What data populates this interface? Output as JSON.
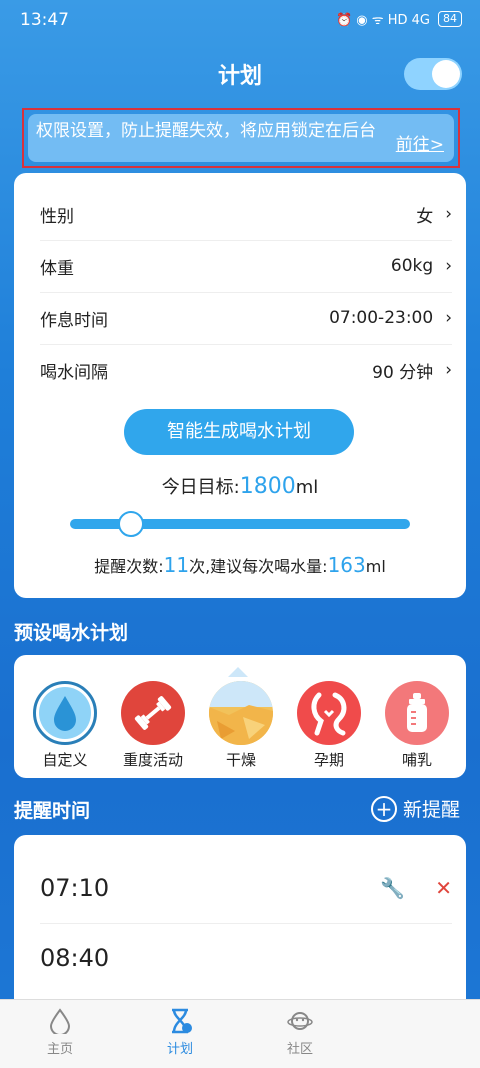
{
  "status": {
    "time": "13:47",
    "icons": "⏰ ◉ ᯤ HD 4G",
    "battery": "84"
  },
  "header": {
    "title": "计划"
  },
  "notice": {
    "text": "权限设置，防止提醒失效，将应用锁定在后台",
    "link": "前往>"
  },
  "settings": {
    "rows": [
      {
        "label": "性别",
        "value": "女"
      },
      {
        "label": "体重",
        "value": "60kg"
      },
      {
        "label": "作息时间",
        "value": "07:00-23:00"
      },
      {
        "label": "喝水间隔",
        "value": "90 分钟"
      }
    ],
    "chevron": "›",
    "generate_button": "智能生成喝水计划",
    "goal_prefix": "今日目标:",
    "goal_value": "1800",
    "goal_unit": "ml",
    "slider_level": 0.18,
    "tip_prefix": "提醒次数:",
    "tip_count": "11",
    "tip_mid": "次,建议每次喝水量:",
    "tip_amount": "163",
    "tip_unit": "ml"
  },
  "presets": {
    "title": "预设喝水计划",
    "items": [
      {
        "label": "自定义",
        "color": "#2ea3ec"
      },
      {
        "label": "重度活动",
        "color": "#e0453c"
      },
      {
        "label": "干燥",
        "color": "#f2c25a"
      },
      {
        "label": "孕期",
        "color": "#f04b4b"
      },
      {
        "label": "哺乳",
        "color": "#f3787a"
      }
    ]
  },
  "reminders": {
    "title": "提醒时间",
    "add_label": "新提醒",
    "plus": "+",
    "items": [
      {
        "time": "07:10"
      },
      {
        "time": "08:40"
      }
    ],
    "wrench": "🔧",
    "delete": "✕"
  },
  "tabs": [
    {
      "label": "主页"
    },
    {
      "label": "计划"
    },
    {
      "label": "社区"
    }
  ]
}
